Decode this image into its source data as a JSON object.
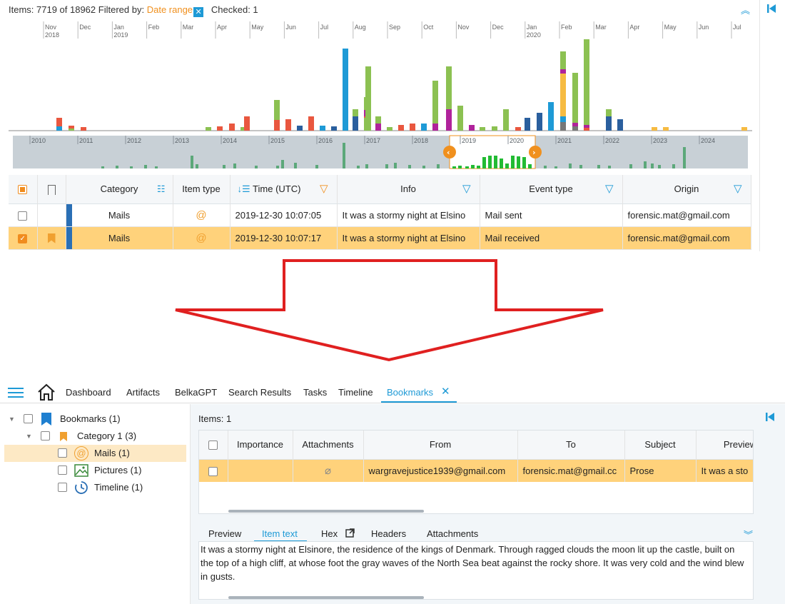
{
  "top": {
    "status": {
      "items_label": "Items: 7719 of 18962",
      "filtered_label": "Filtered by:",
      "filter_value": "Date range",
      "checked_label": "Checked: 1"
    },
    "timeline_months": [
      "Nov\n2018",
      "Dec",
      "Jan\n2019",
      "Feb",
      "Mar",
      "Apr",
      "May",
      "Jun",
      "Jul",
      "Aug",
      "Sep",
      "Oct",
      "Nov",
      "Dec",
      "Jan\n2020",
      "Feb",
      "Mar",
      "Apr",
      "May",
      "Jun",
      "Jul"
    ],
    "overview_years": [
      "2010",
      "2011",
      "2012",
      "2013",
      "2014",
      "2015",
      "2016",
      "2017",
      "2018",
      "2019",
      "2020",
      "2021",
      "2022",
      "2023",
      "2024"
    ],
    "grid": {
      "columns": [
        "Category",
        "Item type",
        "Time (UTC)",
        "Info",
        "Event type",
        "Origin"
      ],
      "rows": [
        {
          "category": "Mails",
          "time": "2019-12-30 10:07:05",
          "info": "It was a stormy night at Elsino",
          "event": "Mail sent",
          "origin": "forensic.mat@gmail.com",
          "checked": false,
          "bookmarked": false
        },
        {
          "category": "Mails",
          "time": "2019-12-30 10:07:17",
          "info": "It was a stormy night at Elsino",
          "event": "Mail received",
          "origin": "forensic.mat@gmail.com",
          "checked": true,
          "bookmarked": true
        }
      ]
    }
  },
  "colors": {
    "accent": "#1e9ad6",
    "highlight_row": "#ffd27b",
    "orange": "#f08c1e",
    "arrow": "#e02020",
    "bar_green": "#8cc152",
    "bar_red": "#e9573f",
    "bar_blue": "#1e9ad6",
    "bar_navy": "#2a5f9e",
    "bar_purple": "#b0239b",
    "bar_yellow": "#f6bb42",
    "bar_gray": "#777777"
  },
  "bottom": {
    "nav_tabs": [
      "Dashboard",
      "Artifacts",
      "BelkaGPT",
      "Search Results",
      "Tasks",
      "Timeline",
      "Bookmarks"
    ],
    "active_tab": "Bookmarks",
    "tree": [
      {
        "label": "Bookmarks (1)",
        "icon": "bookmark-icon"
      },
      {
        "label": "Category 1 (3)",
        "icon": "bookmark-icon"
      },
      {
        "label": "Mails (1)",
        "icon": "mail-at-icon"
      },
      {
        "label": "Pictures (1)",
        "icon": "picture-icon"
      },
      {
        "label": "Timeline (1)",
        "icon": "clock-icon"
      }
    ],
    "items_count": "Items: 1",
    "grid": {
      "columns": [
        "Importance",
        "Attachments",
        "From",
        "To",
        "Subject",
        "Preview"
      ],
      "row": {
        "from": "wargravejustice1939@gmail.com",
        "to": "forensic.mat@gmail.cc",
        "subject": "Prose",
        "preview": "It was a sto"
      }
    },
    "preview_tabs": [
      "Preview",
      "Item text",
      "Hex",
      "Headers",
      "Attachments"
    ],
    "active_preview_tab": "Item text",
    "item_text": "It was a stormy night at Elsinore, the residence of the kings of Denmark. Through ragged clouds the moon lit up the castle, built on the top of a high cliff, at whose foot the gray waves of the North Sea beat against the rocky shore. It was very cold and the wind blew in gusts."
  }
}
